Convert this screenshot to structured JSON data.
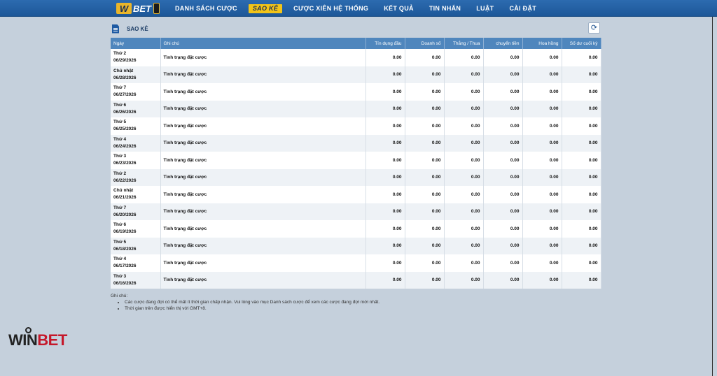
{
  "logo": {
    "text": "BET",
    "mark": "W"
  },
  "nav": [
    {
      "label": "DANH SÁCH CƯỢC"
    },
    {
      "label": "SAO KÊ",
      "active": true
    },
    {
      "label": "CƯỢC XIÊN HỆ THỐNG"
    },
    {
      "label": "KẾT QUẢ"
    },
    {
      "label": "TIN NHẮN"
    },
    {
      "label": "LUẬT"
    },
    {
      "label": "CÀI ĐẶT"
    }
  ],
  "panel": {
    "title": "SAO KÊ",
    "refresh_icon": "refresh-icon"
  },
  "columns": [
    "Ngày",
    "Ghi chú",
    "Tín dụng đầu",
    "Doanh số",
    "Thắng / Thua",
    "chuyển tiền",
    "Hoa hồng",
    "Số dư cuối kỳ"
  ],
  "rows": [
    {
      "day": "Thứ 2",
      "date": "06/29/2026",
      "note": "Tình trạng đặt cược",
      "values": [
        "0.00",
        "0.00",
        "0.00",
        "0.00",
        "0.00",
        "0.00"
      ]
    },
    {
      "day": "Chủ nhật",
      "date": "06/28/2026",
      "note": "Tình trạng đặt cược",
      "values": [
        "0.00",
        "0.00",
        "0.00",
        "0.00",
        "0.00",
        "0.00"
      ]
    },
    {
      "day": "Thứ 7",
      "date": "06/27/2026",
      "note": "Tình trạng đặt cược",
      "values": [
        "0.00",
        "0.00",
        "0.00",
        "0.00",
        "0.00",
        "0.00"
      ]
    },
    {
      "day": "Thứ 6",
      "date": "06/26/2026",
      "note": "Tình trạng đặt cược",
      "values": [
        "0.00",
        "0.00",
        "0.00",
        "0.00",
        "0.00",
        "0.00"
      ]
    },
    {
      "day": "Thứ 5",
      "date": "06/25/2026",
      "note": "Tình trạng đặt cược",
      "values": [
        "0.00",
        "0.00",
        "0.00",
        "0.00",
        "0.00",
        "0.00"
      ]
    },
    {
      "day": "Thứ 4",
      "date": "06/24/2026",
      "note": "Tình trạng đặt cược",
      "values": [
        "0.00",
        "0.00",
        "0.00",
        "0.00",
        "0.00",
        "0.00"
      ]
    },
    {
      "day": "Thứ 3",
      "date": "06/23/2026",
      "note": "Tình trạng đặt cược",
      "values": [
        "0.00",
        "0.00",
        "0.00",
        "0.00",
        "0.00",
        "0.00"
      ]
    },
    {
      "day": "Thứ 2",
      "date": "06/22/2026",
      "note": "Tình trạng đặt cược",
      "values": [
        "0.00",
        "0.00",
        "0.00",
        "0.00",
        "0.00",
        "0.00"
      ]
    },
    {
      "day": "Chủ nhật",
      "date": "06/21/2026",
      "note": "Tình trạng đặt cược",
      "values": [
        "0.00",
        "0.00",
        "0.00",
        "0.00",
        "0.00",
        "0.00"
      ]
    },
    {
      "day": "Thứ 7",
      "date": "06/20/2026",
      "note": "Tình trạng đặt cược",
      "values": [
        "0.00",
        "0.00",
        "0.00",
        "0.00",
        "0.00",
        "0.00"
      ]
    },
    {
      "day": "Thứ 6",
      "date": "06/19/2026",
      "note": "Tình trạng đặt cược",
      "values": [
        "0.00",
        "0.00",
        "0.00",
        "0.00",
        "0.00",
        "0.00"
      ]
    },
    {
      "day": "Thứ 5",
      "date": "06/18/2026",
      "note": "Tình trạng đặt cược",
      "values": [
        "0.00",
        "0.00",
        "0.00",
        "0.00",
        "0.00",
        "0.00"
      ]
    },
    {
      "day": "Thứ 4",
      "date": "06/17/2026",
      "note": "Tình trạng đặt cược",
      "values": [
        "0.00",
        "0.00",
        "0.00",
        "0.00",
        "0.00",
        "0.00"
      ]
    },
    {
      "day": "Thứ 3",
      "date": "06/16/2026",
      "note": "Tình trạng đặt cược",
      "values": [
        "0.00",
        "0.00",
        "0.00",
        "0.00",
        "0.00",
        "0.00"
      ]
    }
  ],
  "notes": {
    "heading": "Ghi chú:",
    "items": [
      "Các cược đang đợi có thể mất ít thời gian chấp nhận. Vui lòng vào mục Danh sách cược để xem các cược đang đợi mới nhất.",
      "Thời gian trên được hiển thị với GMT+8."
    ]
  },
  "brand": {
    "win": "WIN",
    "bet": "BET"
  },
  "colors": {
    "nav_bg": "#1d5798",
    "active_tab": "#f2c418",
    "header_row": "#4f86bd",
    "page_bg": "#c5d0dc",
    "brand_red": "#c5172a"
  }
}
